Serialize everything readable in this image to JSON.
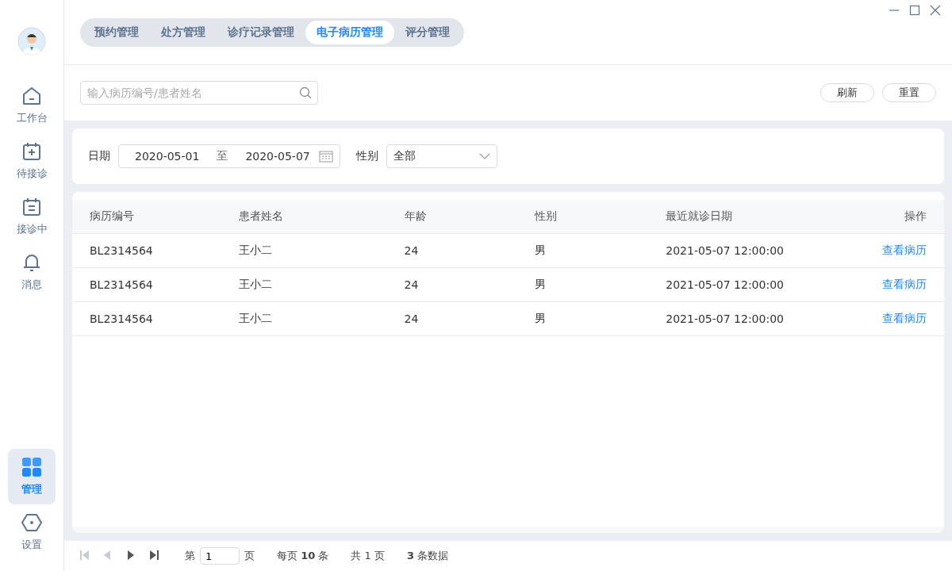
{
  "sidebar": {
    "items": [
      {
        "label": "工作台",
        "kind": "home",
        "selected": false
      },
      {
        "label": "待接诊",
        "kind": "calendar-plus",
        "selected": false
      },
      {
        "label": "接诊中",
        "kind": "calendar-list",
        "selected": false
      },
      {
        "label": "消息",
        "kind": "bell",
        "selected": false
      }
    ],
    "bottom_items": [
      {
        "label": "管理",
        "kind": "grid",
        "selected": true
      },
      {
        "label": "设置",
        "kind": "hexagon",
        "selected": false
      }
    ]
  },
  "tabs": [
    {
      "label": "预约管理",
      "selected": false
    },
    {
      "label": "处方管理",
      "selected": false
    },
    {
      "label": "诊疗记录管理",
      "selected": false
    },
    {
      "label": "电子病历管理",
      "selected": true
    },
    {
      "label": "评分管理",
      "selected": false
    }
  ],
  "search": {
    "placeholder": "输入病历编号/患者姓名"
  },
  "buttons": [
    "刷新",
    "重置"
  ],
  "filters": {
    "date_label": "日期",
    "date_from": "2020-05-01",
    "date_sep": "至",
    "date_to": "2020-05-07",
    "gender_label": "性别",
    "gender_value": "全部"
  },
  "table": {
    "columns": [
      "病历编号",
      "患者姓名",
      "年龄",
      "性别",
      "最近就诊日期",
      "操作"
    ],
    "rows": [
      {
        "cells": [
          "BL2314564",
          "王小二",
          "24",
          "男",
          "2021-05-07 12:00:00"
        ],
        "action": "查看病历"
      },
      {
        "cells": [
          "BL2314564",
          "王小二",
          "24",
          "男",
          "2021-05-07 12:00:00"
        ],
        "action": "查看病历"
      },
      {
        "cells": [
          "BL2314564",
          "王小二",
          "24",
          "男",
          "2021-05-07 12:00:00"
        ],
        "action": "查看病历"
      }
    ]
  },
  "pager": {
    "nav": [
      {
        "kind": "first",
        "disabled": true
      },
      {
        "kind": "prev",
        "disabled": true
      },
      {
        "kind": "next",
        "disabled": false
      },
      {
        "kind": "last",
        "disabled": false
      }
    ],
    "page_prefix": "第",
    "page": "1",
    "page_suffix": "页",
    "per_page": "每页 **10** 条",
    "total_pages": "共 1 页",
    "total": "**3** 条数据"
  }
}
